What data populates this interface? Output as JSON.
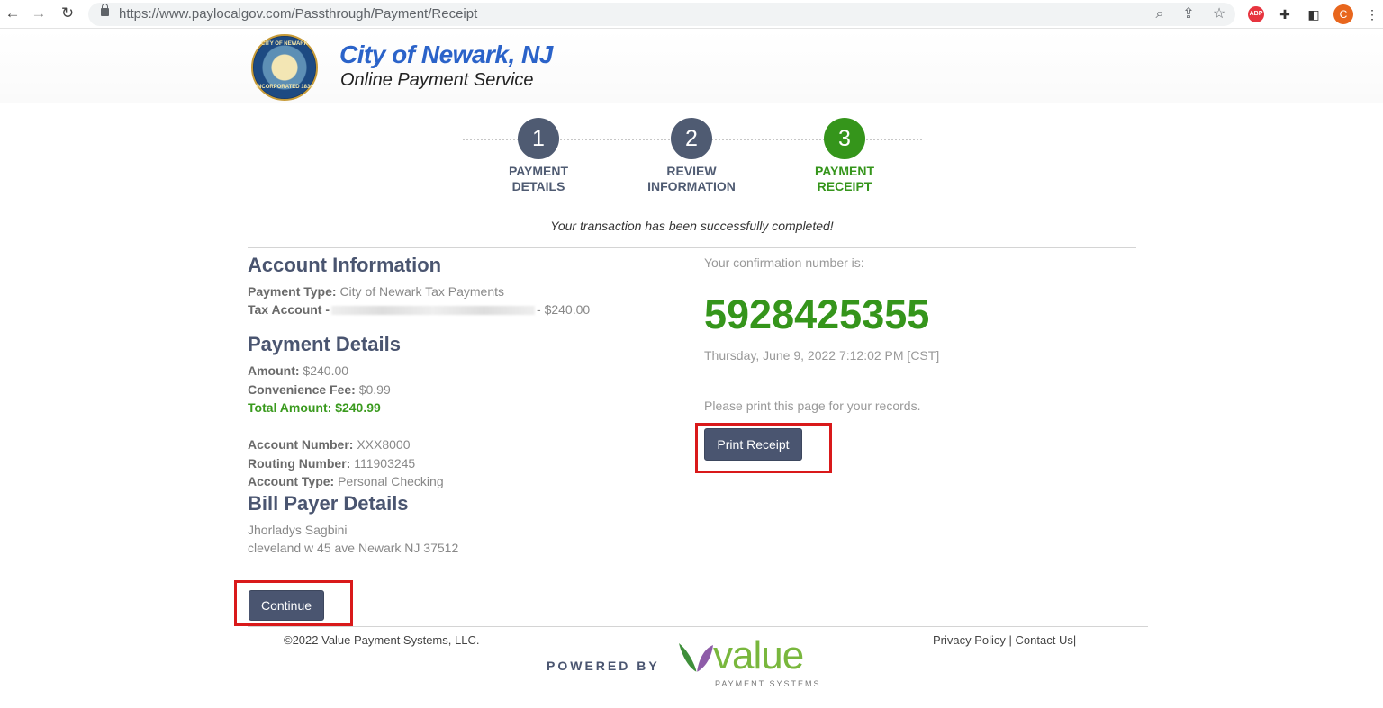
{
  "browser": {
    "url": "https://www.paylocalgov.com/Passthrough/Payment/Receipt",
    "profile_initial": "C",
    "abp_label": "ABP"
  },
  "header": {
    "title": "City of Newark, NJ",
    "subtitle": "Online Payment Service",
    "seal_text_top": "CITY OF NEWARK",
    "seal_text_bottom": "INCORPORATED 1836"
  },
  "steps": [
    {
      "number": "1",
      "line1": "PAYMENT",
      "line2": "DETAILS"
    },
    {
      "number": "2",
      "line1": "REVIEW",
      "line2": "INFORMATION"
    },
    {
      "number": "3",
      "line1": "PAYMENT",
      "line2": "RECEIPT"
    }
  ],
  "success_message": "Your transaction has been successfully completed!",
  "account_info": {
    "title": "Account Information",
    "payment_type_label": "Payment Type:",
    "payment_type_value": "City of Newark Tax Payments",
    "tax_account_label": "Tax Account -",
    "tax_account_amount": "- $240.00"
  },
  "payment_details": {
    "title": "Payment Details",
    "amount_label": "Amount:",
    "amount_value": "$240.00",
    "fee_label": "Convenience Fee:",
    "fee_value": "$0.99",
    "total_label": "Total Amount:",
    "total_value": "$240.99",
    "account_number_label": "Account Number:",
    "account_number_value": "XXX8000",
    "routing_label": "Routing Number:",
    "routing_value": "111903245",
    "account_type_label": "Account Type:",
    "account_type_value": "Personal Checking"
  },
  "bill_payer": {
    "title": "Bill Payer Details",
    "name": "Jhorladys Sagbini",
    "address": "cleveland w 45 ave Newark NJ 37512"
  },
  "buttons": {
    "continue": "Continue",
    "print": "Print Receipt"
  },
  "confirmation": {
    "label": "Your confirmation number is:",
    "number": "5928425355",
    "date": "Thursday, June 9, 2022 7:12:02 PM [CST]",
    "print_note": "Please print this page for your records."
  },
  "footer": {
    "copyright": "©2022 Value Payment Systems, LLC.",
    "privacy": "Privacy Policy",
    "separator": " | ",
    "contact": "Contact Us|",
    "powered_by": "POWERED BY",
    "logo_word": "value",
    "logo_sub": "PAYMENT SYSTEMS"
  },
  "colors": {
    "primary": "#4a5570",
    "success": "#35951b",
    "brand_blue": "#2b63c9",
    "highlight": "#d9191a"
  }
}
